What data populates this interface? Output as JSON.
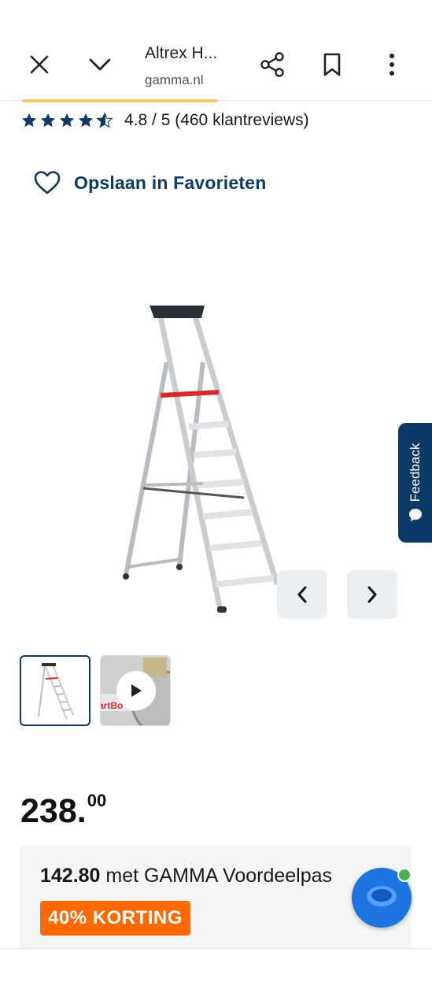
{
  "browser": {
    "title": "Altrex H...",
    "url": "gamma.nl",
    "icons": [
      "close-icon",
      "chevron-down-icon",
      "share-icon",
      "bookmark-icon",
      "more-vert-icon"
    ]
  },
  "rating": {
    "value": 4.8,
    "stars_filled": 4.5,
    "text": "4.8 / 5 (460 klantreviews)"
  },
  "favorites": {
    "label": "Opslaan in Favorieten"
  },
  "gallery": {
    "thumbnails": [
      {
        "type": "image",
        "selected": true
      },
      {
        "type": "video",
        "partial_text": "artBo"
      }
    ]
  },
  "feedback": {
    "label": "Feedback"
  },
  "price": {
    "main": "238.",
    "cents": "00"
  },
  "promo": {
    "amount": "142.80",
    "text": " met GAMMA Voordeelpas",
    "badge": "40% KORTING"
  },
  "colors": {
    "brand_blue": "#0b3a67",
    "orange": "#ff6a00",
    "chat_blue": "#1e74e0"
  }
}
